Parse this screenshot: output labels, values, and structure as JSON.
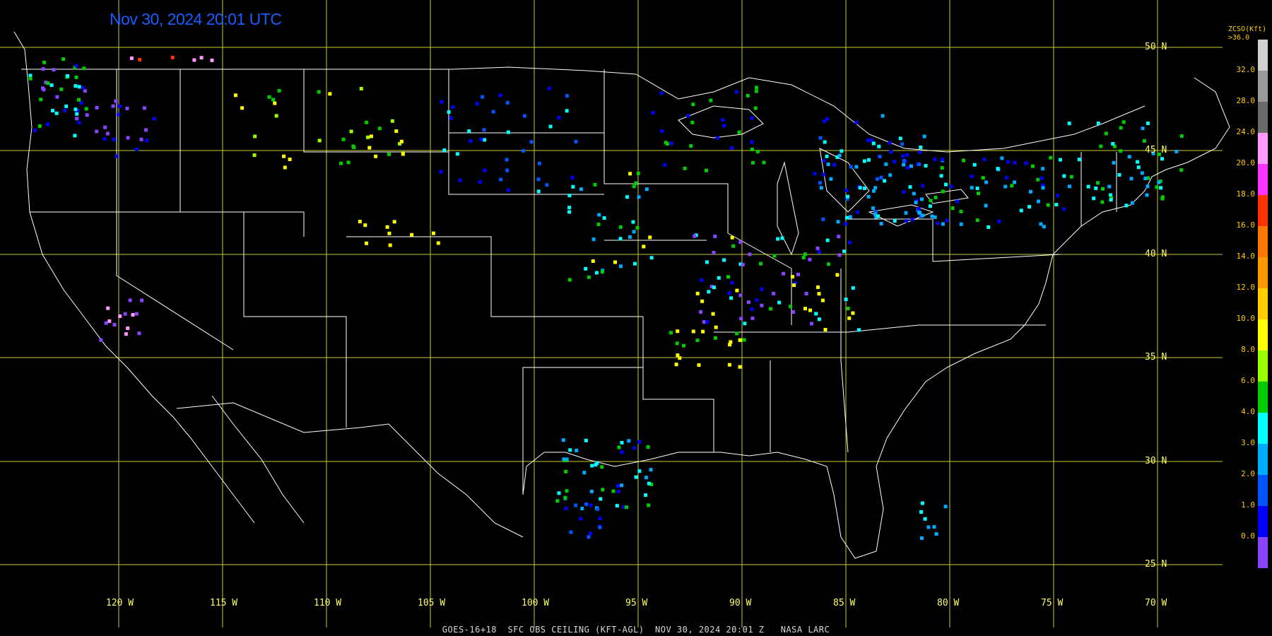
{
  "header": {
    "timestamp": "Nov 30, 2024 20:01 UTC"
  },
  "footer": {
    "caption": "GOES-16+18  SFC OBS CEILING (KFT-AGL)  NOV 30, 2024 20:01 Z   NASA LARC"
  },
  "legend": {
    "title_line1": "ZCSO(Kft)",
    "title_line2": ">36.0",
    "ticks": [
      "32.0",
      "28.0",
      "24.0",
      "20.0",
      "18.0",
      "16.0",
      "14.0",
      "12.0",
      "10.0",
      "8.0",
      "6.0",
      "4.0",
      "3.0",
      "2.0",
      "1.0",
      "0.0"
    ],
    "colors": [
      "#d0d0d0",
      "#9a9a9a",
      "#6a6a6a",
      "#ff99ff",
      "#ff33ff",
      "#ff3300",
      "#ff7700",
      "#ff9900",
      "#ffcc00",
      "#ffff00",
      "#99ff00",
      "#00cc00",
      "#00ffff",
      "#00aaff",
      "#0055ff",
      "#0000ff",
      "#8844ff"
    ]
  },
  "grid": {
    "lat_labels": [
      "50 N",
      "45 N",
      "40 N",
      "35 N",
      "30 N",
      "25 N"
    ],
    "lon_labels": [
      "120 W",
      "115 W",
      "110 W",
      "105 W",
      "100 W",
      "95 W",
      "90 W",
      "85 W",
      "80 W",
      "75 W",
      "70 W"
    ],
    "line_color": "#cccc33"
  },
  "observations": {
    "colors": {
      "purple": "#8844ff",
      "blue": "#0000ff",
      "mid_blue": "#0055ff",
      "light_blue": "#00aaff",
      "cyan": "#00ffff",
      "green": "#00cc00",
      "lime": "#99ff00",
      "yellow": "#ffff00",
      "orange": "#ff9900",
      "red": "#ff3300",
      "pink": "#ff99ff",
      "gray": "#808080"
    }
  }
}
